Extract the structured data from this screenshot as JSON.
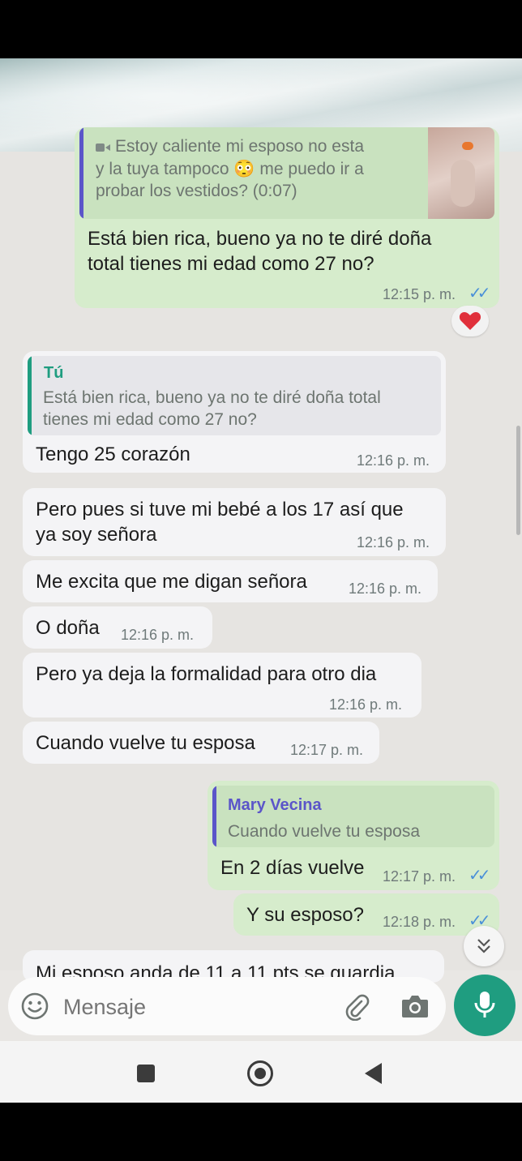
{
  "messages": {
    "m1": {
      "quote_text_1": "Estoy caliente mi esposo no esta",
      "quote_text_2": "y la tuya tampoco 😳 me puedo ir a",
      "quote_text_3": "probar los vestidos? (0:07)",
      "text_1": "Está bien rica, bueno ya no te diré doña",
      "text_2": "total tienes mi edad como 27 no?",
      "time": "12:15 p. m.",
      "reaction": "❤️"
    },
    "m2": {
      "quote_name": "Tú",
      "quote_text_1": "Está bien rica, bueno ya no te diré doña total",
      "quote_text_2": "tienes mi edad como 27 no?",
      "text": "Tengo 25 corazón",
      "time": "12:16 p. m."
    },
    "m3": {
      "text_1": "Pero pues si tuve mi bebé a los 17 así que",
      "text_2": "ya soy señora",
      "time": "12:16 p. m."
    },
    "m4": {
      "text": "Me excita que me digan señora",
      "time": "12:16 p. m."
    },
    "m5": {
      "text": "O doña",
      "time": "12:16 p. m."
    },
    "m6": {
      "text": "Pero ya deja la formalidad para otro dia",
      "time": "12:16 p. m."
    },
    "m7": {
      "text": "Cuando vuelve tu esposa",
      "time": "12:17 p. m."
    },
    "m8": {
      "quote_name": "Mary Vecina",
      "quote_text": "Cuando vuelve tu esposa",
      "text": "En 2 días vuelve",
      "time": "12:17 p. m."
    },
    "m9": {
      "text": "Y su esposo?",
      "time": "12:18 p. m."
    },
    "m10_partial": "Mi esposo anda de 11 a 11 pts se guardia"
  },
  "input": {
    "placeholder": "Mensaje"
  },
  "icons": {
    "emoji": "emoji-icon",
    "attach": "paperclip-icon",
    "camera": "camera-icon",
    "mic": "microphone-icon",
    "scroll": "chevrons-down-icon",
    "video": "video-icon"
  },
  "colors": {
    "outgoing_bubble": "#d6eccc",
    "incoming_bubble": "#f4f4f6",
    "accent": "#1f9d80",
    "read_ticks": "#4a90d8",
    "quote_you": "#1f9d80",
    "quote_contact": "#5b55c9"
  }
}
